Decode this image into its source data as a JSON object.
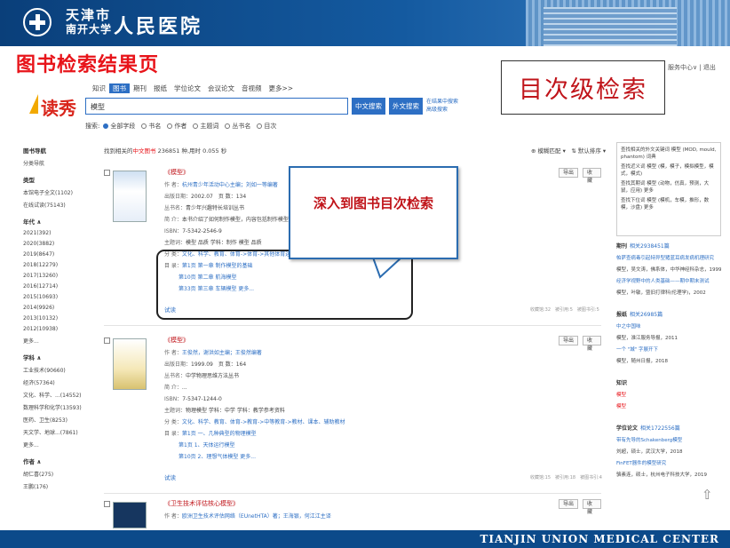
{
  "header": {
    "name_line1": "天津市",
    "name_line2": "南开大学",
    "name_main": "人民医院"
  },
  "slide": {
    "title": "图书检索结果页",
    "callout": "目次级检索",
    "balloon": "深入到图书目次检索"
  },
  "toplinks": "服务中心∨ | 退出",
  "brand": "读秀",
  "channels": [
    "知识",
    "图书",
    "期刊",
    "报纸",
    "学位论文",
    "会议论文",
    "音视频",
    "更多>>"
  ],
  "active_channel": "图书",
  "search": {
    "value": "模型",
    "btn_cn": "中文搜索",
    "btn_en": "外文搜索",
    "adv1": "在结果中搜索",
    "adv2": "高级搜索"
  },
  "search_options": {
    "label": "搜索:",
    "items": [
      "全部字段",
      "书名",
      "作者",
      "主题词",
      "丛书名",
      "目次"
    ]
  },
  "sidebar": {
    "items": [
      {
        "t": "图书导航",
        "g": true
      },
      {
        "t": "分类导航",
        "g": false
      },
      {
        "t": "类型",
        "g": true
      },
      {
        "t": "本馆电子全文(1102)",
        "g": false
      },
      {
        "t": "在线试读(75143)",
        "g": false
      },
      {
        "t": "年代 ∧",
        "g": true
      },
      {
        "t": "2021(392)",
        "g": false
      },
      {
        "t": "2020(3882)",
        "g": false
      },
      {
        "t": "2019(8647)",
        "g": false
      },
      {
        "t": "2018(12279)",
        "g": false
      },
      {
        "t": "2017(13260)",
        "g": false
      },
      {
        "t": "2016(12714)",
        "g": false
      },
      {
        "t": "2015(10693)",
        "g": false
      },
      {
        "t": "2014(9926)",
        "g": false
      },
      {
        "t": "2013(10132)",
        "g": false
      },
      {
        "t": "2012(10938)",
        "g": false
      },
      {
        "t": "更多...",
        "g": false
      },
      {
        "t": "学科 ∧",
        "g": true
      },
      {
        "t": "工业技术(90660)",
        "g": false
      },
      {
        "t": "经济(57364)",
        "g": false
      },
      {
        "t": "文化、科学、...(14552)",
        "g": false
      },
      {
        "t": "数理科学和化学(13593)",
        "g": false
      },
      {
        "t": "医药、卫生(8253)",
        "g": false
      },
      {
        "t": "天文学、地球...(7861)",
        "g": false
      },
      {
        "t": "更多...",
        "g": false
      },
      {
        "t": "作者 ∧",
        "g": true
      },
      {
        "t": "胡仁喜(275)",
        "g": false
      },
      {
        "t": "王鹏(176)",
        "g": false
      }
    ]
  },
  "summary": {
    "prefix": "找到相关的",
    "hl": "中文图书",
    "rest": " 236851 种,用时 0.055 秒"
  },
  "sorts": "⊕ 模糊匹配 ▾　⇅ 默认排序 ▾",
  "results": [
    {
      "title": "《模型》",
      "lines": [
        {
          "l": "作 者：",
          "v": "杭州青少年活动中心主编；刘如一等编著",
          "c": "blue"
        },
        {
          "l": "出版日期：",
          "v": "2002.07　页 数：134",
          "c": ""
        },
        {
          "l": "丛书名：",
          "v": "青少年兴趣特长培训丛书",
          "c": ""
        },
        {
          "l": "简 介：",
          "v": "本书介绍了如何制作模型，内容包括制作模型的基础、模型...",
          "c": ""
        },
        {
          "l": "ISBN：",
          "v": "7-5342-2546-9",
          "c": ""
        },
        {
          "l": "主题词：",
          "v": "模型 品质 学科：制作 模型 品质",
          "c": ""
        },
        {
          "l": "分 类：",
          "v": "文化、科学、教育、体育->体育->其他体育运动",
          "c": "blue"
        }
      ],
      "toc_label": "目 录：",
      "toc": [
        "第1页 第一章 制作模型的基础",
        "第10页 第二章 航海模型",
        "第33页 第三章 车辆模型 更多..."
      ],
      "read": "试读",
      "stats": "收藏馆:32　被引用:5　被图书引:5"
    },
    {
      "title": "《模型》",
      "lines": [
        {
          "l": "作 者：",
          "v": "王俊然，谢洪如主编；王俊然编著",
          "c": "blue"
        },
        {
          "l": "出版日期：",
          "v": "1999.09　页 数：164",
          "c": ""
        },
        {
          "l": "丛书名：",
          "v": "中学物理思维方法丛书",
          "c": ""
        },
        {
          "l": "简 介：",
          "v": "...",
          "c": ""
        },
        {
          "l": "ISBN：",
          "v": "7-5347-1244-0",
          "c": ""
        },
        {
          "l": "主题词：",
          "v": "物理模型 学科：中学 学科：教学参考资料",
          "c": ""
        },
        {
          "l": "分 类：",
          "v": "文化、科学、教育、体育->教育->中等教育->教材、课本、辅助教材",
          "c": "blue"
        }
      ],
      "toc_label": "目 录：",
      "toc": [
        "第1页 一、几种典型的物理模型",
        "第1页 1、天体运行模型",
        "第10页 2、理想气体模型 更多..."
      ],
      "read": "试读",
      "stats": "收藏馆:15　被引用:18　被图书引:4"
    },
    {
      "title": "《卫生技术评估核心模型》",
      "lines": [
        {
          "l": "作 者：",
          "v": "欧洲卫生技术评估网络（EUnetHTA）著；王海银，何江江主译",
          "c": "blue"
        }
      ],
      "toc_label": "",
      "toc": [],
      "read": "",
      "stats": ""
    }
  ],
  "actions": {
    "export": "导出",
    "fav": "收藏"
  },
  "right": {
    "related": [
      "查找相关的外文关键词 模型 (MOD, mould, phantom) 词典",
      "查找近义词 模型 (模，模子，模拟模型，模式，模式)",
      "查找其期词 模型 (动物，仿真，预测，大鼠，应用) 更多",
      "查找下位词 模型 (模机，车模，推形，数模，沙盘) 更多"
    ],
    "journal_head": "期刊",
    "journal_cnt": "相关2938451篇",
    "journal_lines": [
      {
        "t": "帕萨查病毒引起特异型猪蓝耳病发病机理研究",
        "c": "blue"
      },
      {
        "t": "模型，吴文涛，佛系体，中华神经科杂志，1999",
        "c": ""
      },
      {
        "t": "经济学视野中的人类基础——期中期末测试",
        "c": "blue"
      },
      {
        "t": "模型，叶敏，暨旧打律科(伦理学)，2002",
        "c": ""
      }
    ],
    "paper_head": "报纸",
    "paper_cnt": "相关26985篇",
    "paper_lines": [
      {
        "t": "中之中国味",
        "c": "blue"
      },
      {
        "t": "模型，淮江服务导报，2011",
        "c": ""
      },
      {
        "t": "一个 \"城\" 字展开下",
        "c": "blue"
      },
      {
        "t": "模型，随州日报，2018",
        "c": ""
      }
    ],
    "know_head": "知识",
    "know_lines": [
      {
        "t": "模型",
        "c": "red"
      },
      {
        "t": "模型",
        "c": "red"
      }
    ],
    "thesis_head": "学位论文",
    "thesis_cnt": "相关1722556篇",
    "thesis_lines": [
      {
        "t": "带有先导的Schakenberg模型",
        "c": "blue"
      },
      {
        "t": "刘超，硕士，武汉大学，2018",
        "c": ""
      },
      {
        "t": "FinFET器件的模型研究",
        "c": "blue"
      },
      {
        "t": "骆素连，硕士，杭州电子科技大学，2019",
        "c": ""
      }
    ]
  },
  "footer": "TIANJIN UNION MEDICAL CENTER",
  "scroll_icon": "⇧"
}
